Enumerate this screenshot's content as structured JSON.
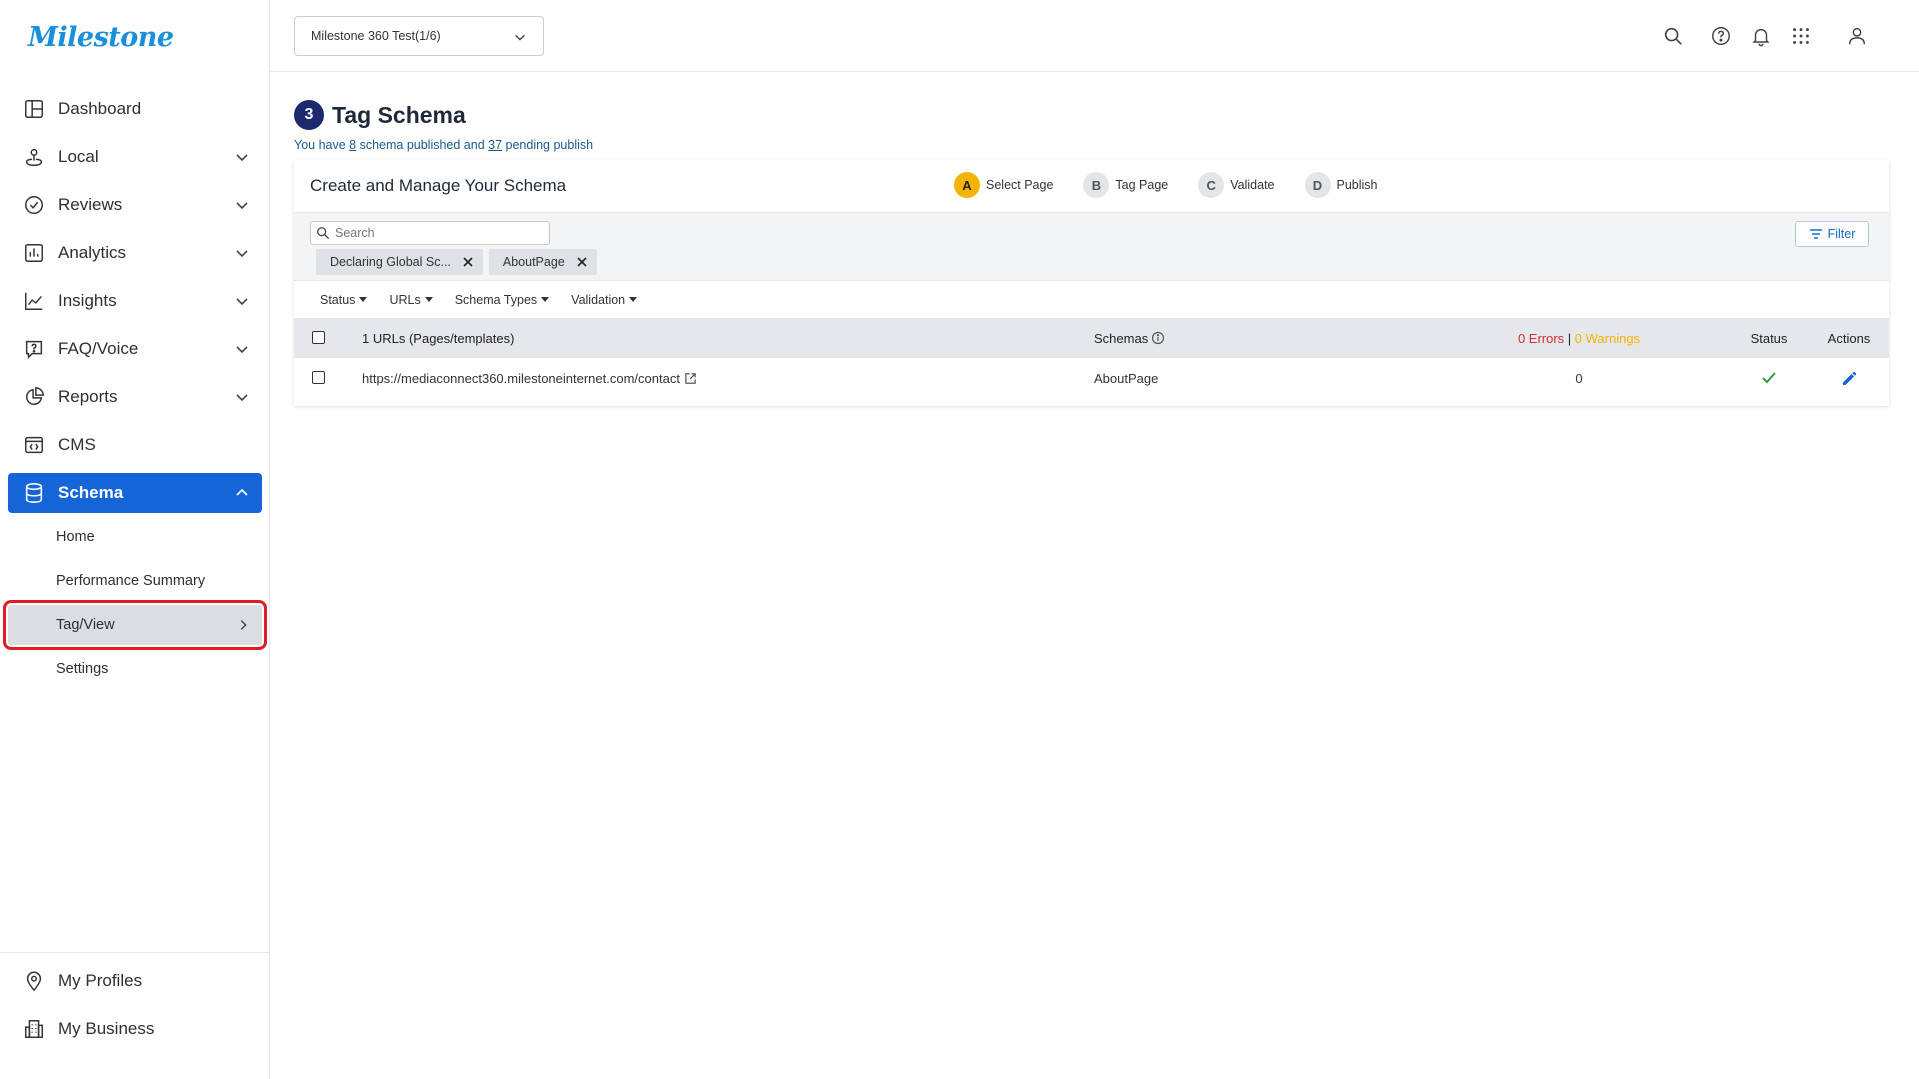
{
  "app": {
    "logo_text": "Milestone"
  },
  "sidebar": {
    "items": [
      {
        "label": "Dashboard",
        "icon": "dashboard-icon"
      },
      {
        "label": "Local",
        "icon": "local-pin-icon"
      },
      {
        "label": "Reviews",
        "icon": "reviews-check-icon"
      },
      {
        "label": "Analytics",
        "icon": "analytics-bar-icon"
      },
      {
        "label": "Insights",
        "icon": "insights-line-icon"
      },
      {
        "label": "FAQ/Voice",
        "icon": "faq-bubble-icon"
      },
      {
        "label": "Reports",
        "icon": "reports-pie-icon"
      },
      {
        "label": "CMS",
        "icon": "cms-window-icon"
      },
      {
        "label": "Schema",
        "icon": "database-icon"
      }
    ],
    "schema_sub": [
      {
        "label": "Home"
      },
      {
        "label": "Performance Summary"
      },
      {
        "label": "Tag/View"
      },
      {
        "label": "Settings"
      }
    ],
    "bottom": [
      {
        "label": "My Profiles",
        "icon": "location-pin-icon"
      },
      {
        "label": "My Business",
        "icon": "building-icon"
      }
    ]
  },
  "topbar": {
    "account": "Milestone 360 Test(1/6)",
    "icons": [
      "search-icon",
      "help-icon",
      "bell-icon",
      "apps-grid-icon",
      "user-icon"
    ]
  },
  "page": {
    "step_number": "3",
    "title": "Tag Schema",
    "subtitle_pre": "You have ",
    "published_count": "8",
    "subtitle_mid": " schema published and ",
    "pending_count": "37",
    "subtitle_post": " pending publish"
  },
  "card": {
    "title": "Create and Manage Your Schema",
    "steps": [
      {
        "letter": "A",
        "label": "Select Page"
      },
      {
        "letter": "B",
        "label": "Tag Page"
      },
      {
        "letter": "C",
        "label": "Validate"
      },
      {
        "letter": "D",
        "label": "Publish"
      }
    ],
    "search_placeholder": "Search",
    "chips": [
      {
        "label": "Declaring Global Sc..."
      },
      {
        "label": "AboutPage"
      }
    ],
    "filter_label": "Filter",
    "dropdowns": [
      {
        "label": "Status"
      },
      {
        "label": "URLs"
      },
      {
        "label": "Schema Types"
      },
      {
        "label": "Validation"
      }
    ]
  },
  "table": {
    "headers": {
      "urls": "1 URLs (Pages/templates)",
      "schemas": "Schemas",
      "errors": "0 Errors",
      "sep": " | ",
      "warnings": "0 Warnings",
      "status": "Status",
      "actions": "Actions"
    },
    "rows": [
      {
        "url": "https://mediaconnect360.milestoneinternet.com/contact",
        "schema": "AboutPage",
        "errors": "0",
        "status": "valid"
      }
    ]
  },
  "colors": {
    "primary": "#1565d8",
    "step_active": "#f4b400",
    "error": "#d32f2f",
    "warning": "#f4b400",
    "success": "#2e9e44",
    "highlight": "#e01b24"
  }
}
